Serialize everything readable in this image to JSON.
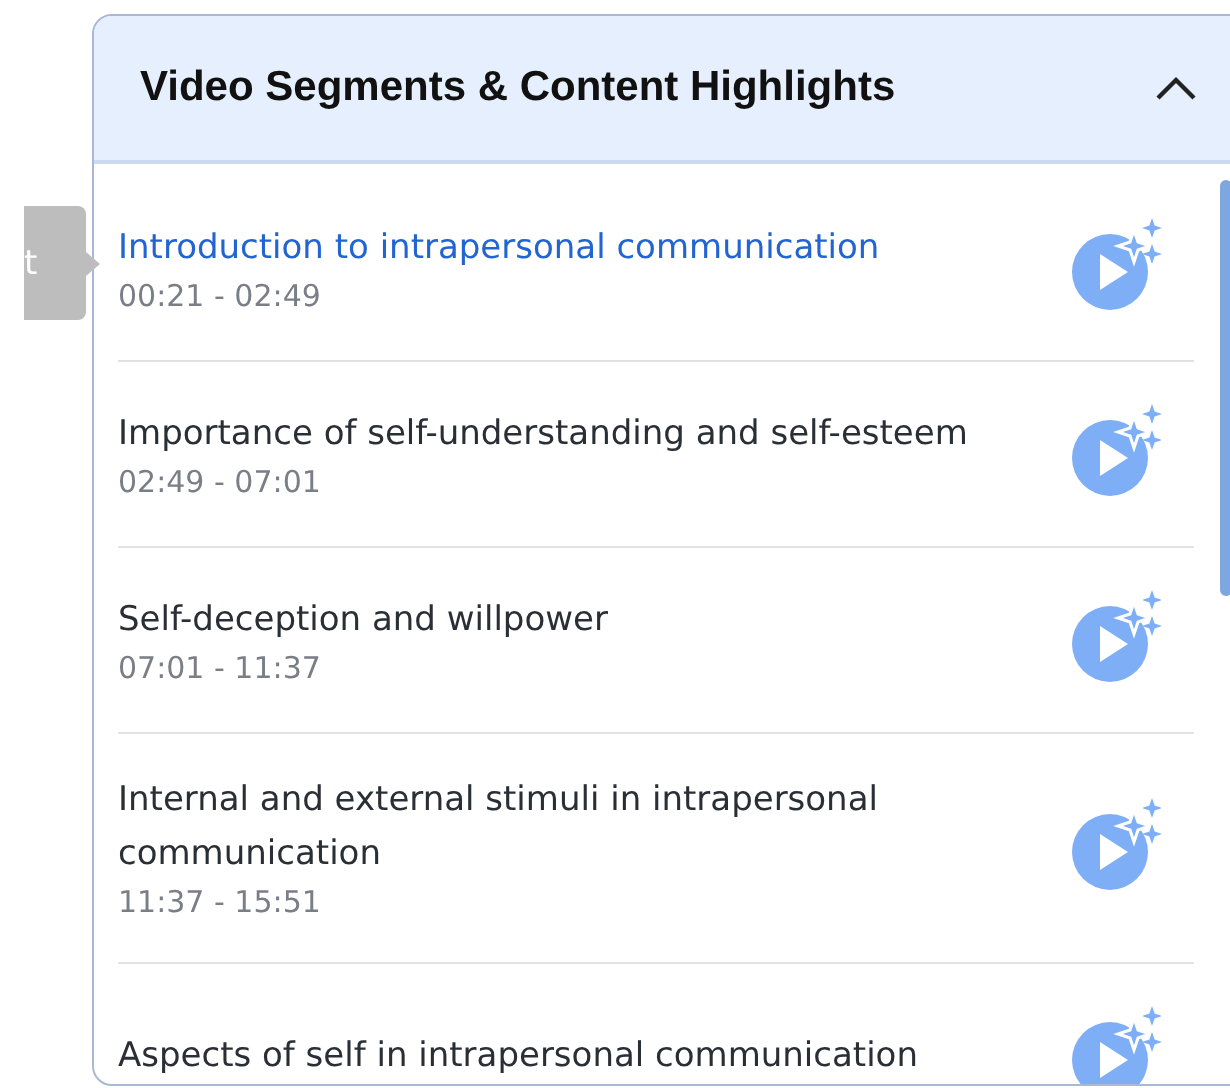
{
  "side_tab": {
    "label": "t"
  },
  "panel": {
    "title": "Video Segments & Content Highlights",
    "expanded": true
  },
  "segments": [
    {
      "title": "Introduction to intrapersonal communication",
      "time": "00:21 - 02:49",
      "selected": true
    },
    {
      "title": "Importance of self-understanding and self-esteem",
      "time": "02:49 - 07:01",
      "selected": false
    },
    {
      "title": "Self-deception and willpower",
      "time": "07:01 - 11:37",
      "selected": false
    },
    {
      "title": "Internal and external stimuli in intrapersonal communication",
      "time": "11:37 - 15:51",
      "selected": false
    },
    {
      "title": "Aspects of self in intrapersonal communication",
      "selected": false
    }
  ]
}
